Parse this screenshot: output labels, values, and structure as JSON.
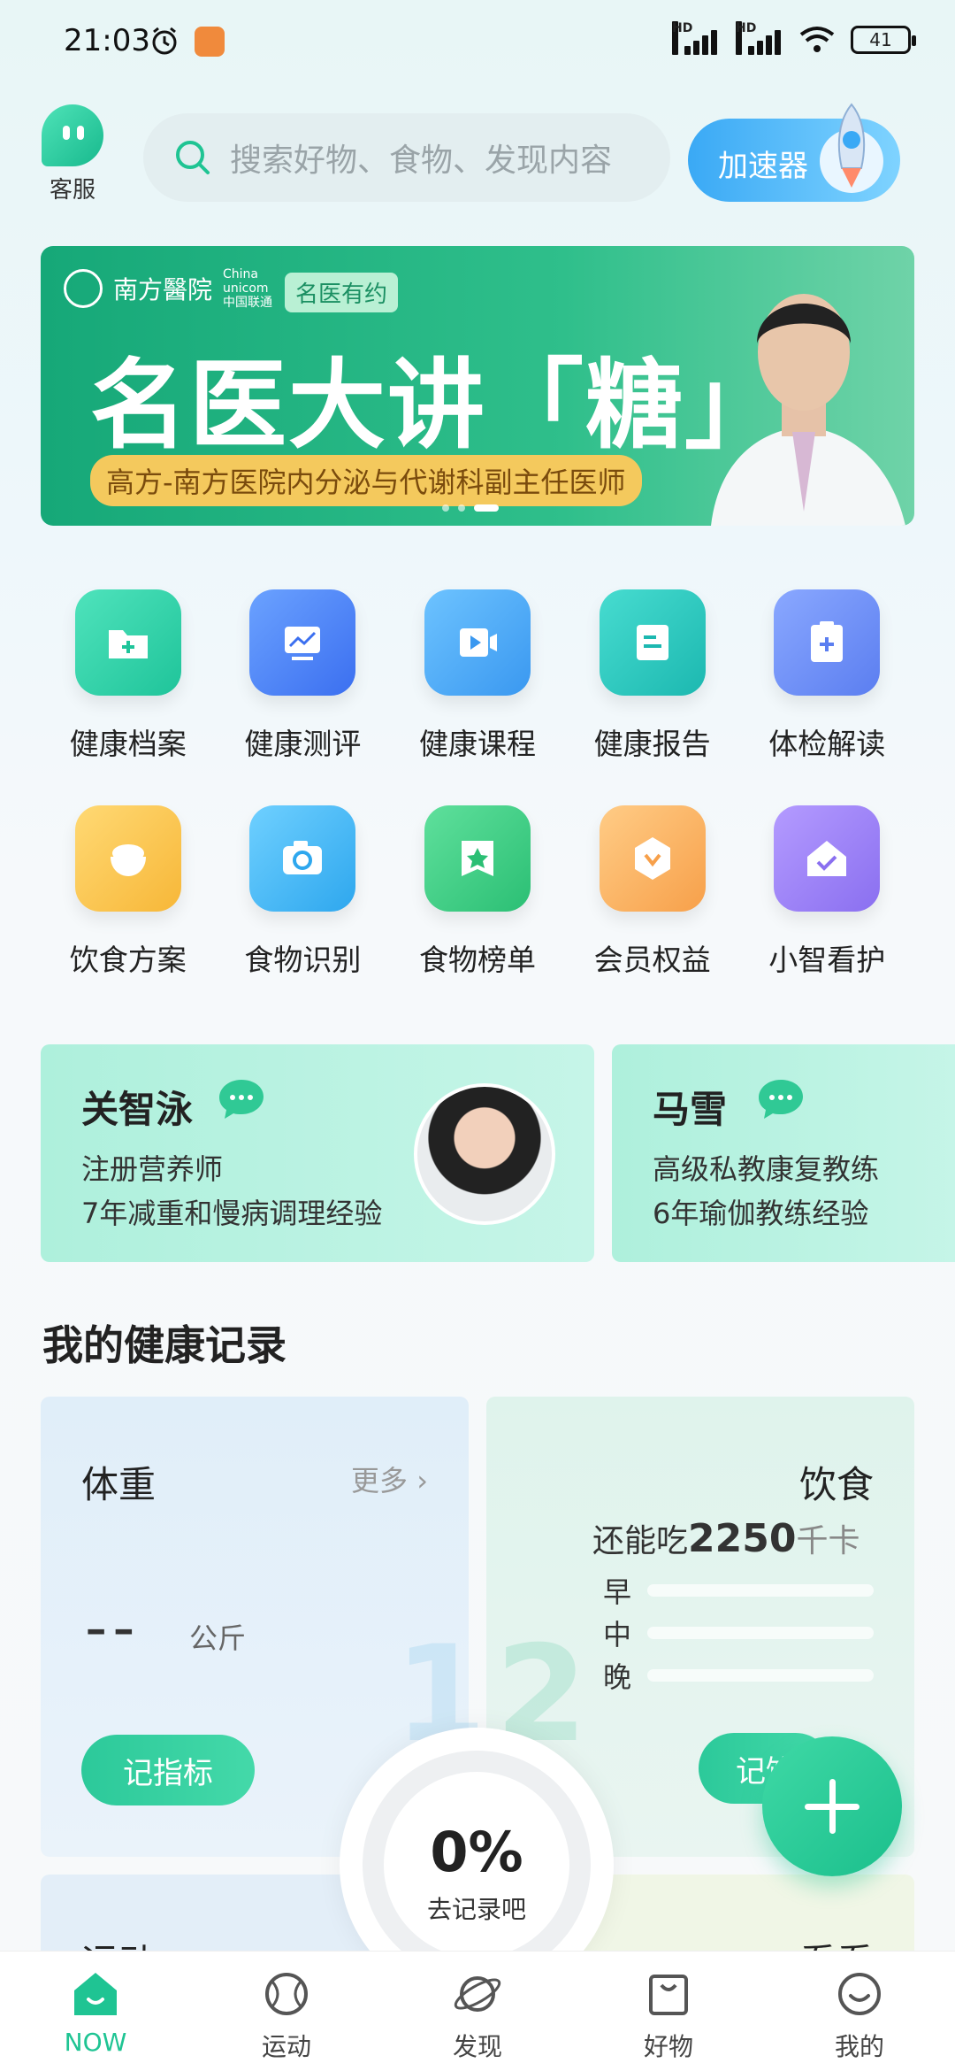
{
  "status_bar": {
    "time": "21:03",
    "signal_labels": [
      "HD",
      "HD"
    ],
    "battery": "41"
  },
  "header": {
    "service_label": "客服",
    "search_placeholder": "搜索好物、食物、发现内容",
    "accelerator_label": "加速器"
  },
  "banner": {
    "brand": "南方醫院",
    "partner": "China unicom中国联通",
    "tag": "名医有约",
    "headline": "名医大讲「糖」",
    "subtitle": "高方-南方医院内分泌与代谢科副主任医师",
    "active_dot": 2
  },
  "grid": {
    "items": [
      {
        "label": "健康档案",
        "icon": "folder-plus-icon",
        "color": "#2fd3a4"
      },
      {
        "label": "健康测评",
        "icon": "chart-line-icon",
        "color": "#4a86f0"
      },
      {
        "label": "健康课程",
        "icon": "video-play-icon",
        "color": "#4aa8f5"
      },
      {
        "label": "健康报告",
        "icon": "document-icon",
        "color": "#2cc9bd"
      },
      {
        "label": "体检解读",
        "icon": "clipboard-plus-icon",
        "color": "#6a8ef5"
      },
      {
        "label": "饮食方案",
        "icon": "bowl-icon",
        "color": "#fbc74f"
      },
      {
        "label": "食物识别",
        "icon": "camera-icon",
        "color": "#47b6f4"
      },
      {
        "label": "食物榜单",
        "icon": "star-badge-icon",
        "color": "#3dcf8a"
      },
      {
        "label": "会员权益",
        "icon": "vip-hexagon-icon",
        "color": "#fbb469"
      },
      {
        "label": "小智看护",
        "icon": "home-check-icon",
        "color": "#9b86f2"
      }
    ]
  },
  "experts": [
    {
      "name": "关智泳",
      "title": "注册营养师",
      "experience": "7年减重和慢病调理经验"
    },
    {
      "name": "马雪",
      "title": "高级私教康复教练",
      "experience": "6年瑜伽教练经验"
    }
  ],
  "health_records": {
    "section_title": "我的健康记录",
    "weight": {
      "title": "体重",
      "more": "更多",
      "value": "--",
      "unit": "公斤",
      "button": "记指标",
      "bg_number": "1"
    },
    "diet": {
      "title": "饮食",
      "remaining_prefix": "还能吃",
      "remaining_value": "2250",
      "remaining_unit": "千卡",
      "meals": [
        "早",
        "中",
        "晚"
      ],
      "button": "记饮食",
      "bg_number": "2"
    },
    "exercise_title": "运动",
    "watch_title": "看看"
  },
  "progress": {
    "percent": "0%",
    "label": "去记录吧",
    "value": 0
  },
  "bottom_nav": {
    "items": [
      {
        "label": "NOW",
        "icon": "home-icon",
        "active": true
      },
      {
        "label": "运动",
        "icon": "baseball-icon",
        "active": false
      },
      {
        "label": "发现",
        "icon": "planet-icon",
        "active": false
      },
      {
        "label": "好物",
        "icon": "bag-icon",
        "active": false
      },
      {
        "label": "我的",
        "icon": "smile-icon",
        "active": false
      }
    ]
  },
  "colors": {
    "accent": "#1fc493",
    "banner": "#2fbf8b",
    "accelerator": "#3aa9f5"
  }
}
